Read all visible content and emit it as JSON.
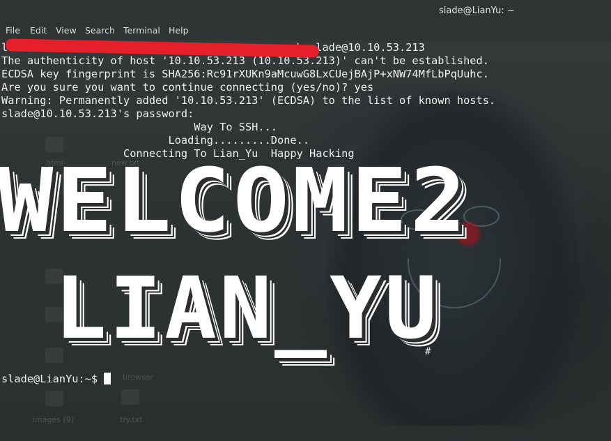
{
  "window": {
    "title": "slade@LianYu: ~"
  },
  "menu": [
    "File",
    "Edit",
    "View",
    "Search",
    "Terminal",
    "Help"
  ],
  "terminal": {
    "lines": [
      "                                            ssh slade@10.10.53.213",
      "The authenticity of host '10.10.53.213 (10.10.53.213)' can't be established.",
      "ECDSA key fingerprint is SHA256:Rc91rXUKn9aMcuwG8LxCUejBAjP+xNW74MfLbPqUuhc.",
      "Are you sure you want to continue connecting (yes/no)? yes",
      "Warning: Permanently added '10.10.53.213' (ECDSA) to the list of known hosts.",
      "slade@10.10.53.213's password:",
      "                              Way To SSH...",
      "                          Loading.........Done..",
      "                   Connecting To Lian_Yu  Happy Hacking"
    ],
    "prompt_prefix": "lo",
    "banner_line1": "WELCOME2",
    "banner_line2": "LIAN_YU",
    "hash_mark": "#",
    "prompt": "slade@LianYu:~$ "
  },
  "desktop_icons": [
    "html",
    "new.txt",
    "images (9)",
    "try.txt",
    "browser"
  ]
}
